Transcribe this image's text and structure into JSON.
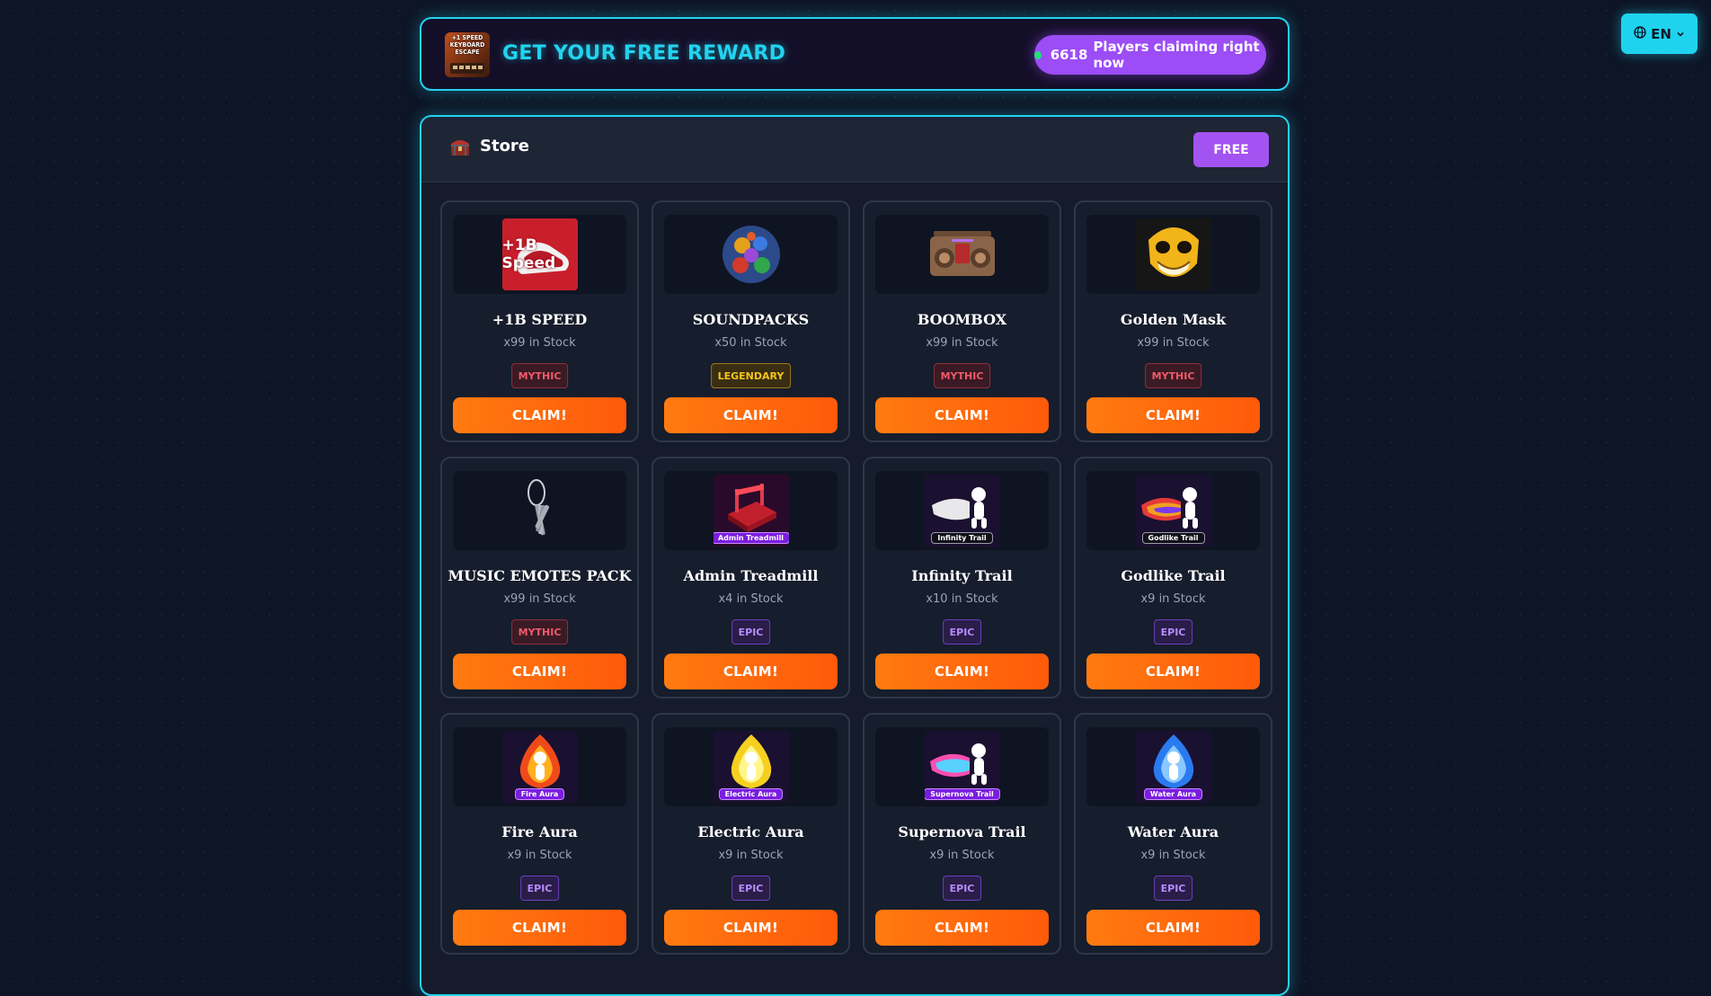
{
  "language": {
    "label": "EN"
  },
  "header": {
    "logo_text": "+1 SPEED KEYBOARD ESCAPE",
    "title": "GET YOUR FREE REWARD",
    "players_count": "6618",
    "players_text": "Players claiming right now"
  },
  "store": {
    "title": "Store",
    "filter_label": "FREE",
    "items": [
      {
        "name": "+1B SPEED",
        "stock": "x99 in Stock",
        "rarity": "MYTHIC",
        "claim": "CLAIM!",
        "thumb_text": "+1B Speed"
      },
      {
        "name": "SOUNDPACKS",
        "stock": "x50 in Stock",
        "rarity": "LEGENDARY",
        "claim": "CLAIM!"
      },
      {
        "name": "BOOMBOX",
        "stock": "x99 in Stock",
        "rarity": "MYTHIC",
        "claim": "CLAIM!"
      },
      {
        "name": "Golden Mask",
        "stock": "x99 in Stock",
        "rarity": "MYTHIC",
        "claim": "CLAIM!"
      },
      {
        "name": "MUSIC EMOTES PACK",
        "stock": "x99 in Stock",
        "rarity": "MYTHIC",
        "claim": "CLAIM!"
      },
      {
        "name": "Admin Treadmill",
        "stock": "x4 in Stock",
        "rarity": "EPIC",
        "claim": "CLAIM!",
        "thumb_text": "Admin Treadmill"
      },
      {
        "name": "Infinity Trail",
        "stock": "x10 in Stock",
        "rarity": "EPIC",
        "claim": "CLAIM!",
        "thumb_text": "Infinity Trail"
      },
      {
        "name": "Godlike Trail",
        "stock": "x9 in Stock",
        "rarity": "EPIC",
        "claim": "CLAIM!",
        "thumb_text": "Godlike Trail"
      },
      {
        "name": "Fire Aura",
        "stock": "x9 in Stock",
        "rarity": "EPIC",
        "claim": "CLAIM!",
        "thumb_text": "Fire Aura"
      },
      {
        "name": "Electric Aura",
        "stock": "x9 in Stock",
        "rarity": "EPIC",
        "claim": "CLAIM!",
        "thumb_text": "Electric Aura"
      },
      {
        "name": "Supernova Trail",
        "stock": "x9 in Stock",
        "rarity": "EPIC",
        "claim": "CLAIM!",
        "thumb_text": "Supernova Trail"
      },
      {
        "name": "Water Aura",
        "stock": "x9 in Stock",
        "rarity": "EPIC",
        "claim": "CLAIM!",
        "thumb_text": "Water Aura"
      }
    ]
  },
  "colors": {
    "accent_cyan": "#22d3ee",
    "purple": "#9c4df6",
    "claim_orange": "#ff6a0f",
    "mythic": "#f05a6a",
    "legendary": "#f5c518",
    "epic": "#b78bff"
  }
}
